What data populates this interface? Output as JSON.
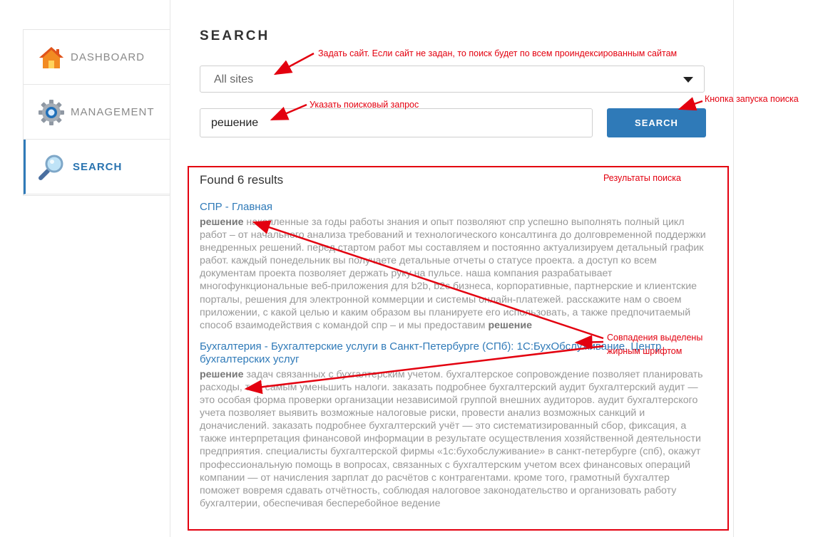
{
  "sidebar": {
    "items": [
      {
        "label": "DASHBOARD",
        "icon": "house-icon"
      },
      {
        "label": "MANAGEMENT",
        "icon": "gear-icon"
      },
      {
        "label": "SEARCH",
        "icon": "magnifier-icon",
        "active": true
      }
    ]
  },
  "main": {
    "title": "SEARCH",
    "site_select": {
      "value": "All sites"
    },
    "query": {
      "value": "решение"
    },
    "search_button": "SEARCH",
    "found_text": "Found 6 results",
    "results": [
      {
        "title": "СПР - Главная",
        "lead": "решение",
        "body": " накопленные за годы работы знания и опыт позволяют спр успешно выполнять полный цикл работ – от начального анализа требований и технологического консалтинга до долговременной поддержки внедренных решений. перед стартом работ мы составляем и постоянно актуализируем детальный график работ. каждый понедельник вы получаете детальные отчеты о статусе проекта. а доступ ко всем документам проекта позволяет держать руку на пульсе. наша компания разрабатывает многофункциональные веб-приложения для b2b, b2c бизнеса, корпоративные, партнерские и клиентские порталы, решения для электронной коммерции и системы онлайн-платежей. расскажите нам о своем приложении, с какой целью и каким образом вы планируете его использовать, а также предпочитаемый способ взаимодействия с командой спр – и мы предоставим ",
        "tail": "решение"
      },
      {
        "title": "Бухгалтерия - Бухгалтерские услуги в Санкт-Петербурге (СПб): 1С:БухОбслуживание. Центр бухгалтерских услуг",
        "lead": "решение",
        "body": " задач связанных с бухгалтерским учетом. бухгалтерское сопровождение позволяет планировать расходы, тем самым уменьшить налоги. заказать подробнее бухгалтерский аудит бухгалтерский аудит — это особая форма проверки организации независимой группой внешних аудиторов. аудит бухгалтерского учета позволяет выявить возможные налоговые риски, провести анализ возможных санкций и доначислений. заказать подробнее бухгалтерский учёт — это систематизированный сбор, фиксация, а также интерпретация финансовой информации в результате осуществления хозяйственной деятельности предприятия. специалисты бухгалтерской фирмы «1с:бухобслуживание» в санкт-петербурге (спб), окажут профессиональную помощь в вопросах, связанных с бухгалтерским учетом всех финансовых операций компании — от начисления зарплат до расчётов с контрагентами. кроме того, грамотный бухгалтер поможет вовремя сдавать отчётность, соблюдая налоговое законодательство и организовать работу бухгалтерии, обеспечивая бесперебойное ведение",
        "tail": ""
      }
    ]
  },
  "annotations": {
    "site_note": "Задать сайт. Если сайт не задан, то поиск будет по всем проиндексированным сайтам",
    "query_note": "Указать поисковый запрос",
    "button_note": "Кнопка запуска поиска",
    "results_note": "Результаты поиска",
    "bold_note_1": "Совпадения выделены",
    "bold_note_2": "жирным шрифтом",
    "color": "#e3000f"
  },
  "colors": {
    "accent": "#2f7ab8"
  }
}
